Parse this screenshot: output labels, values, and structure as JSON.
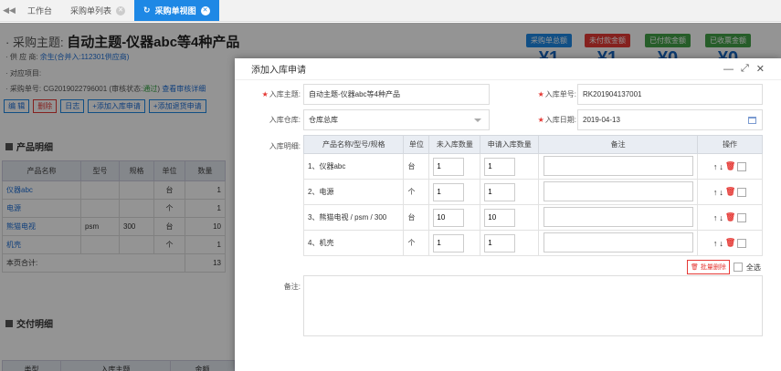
{
  "tabs": [
    {
      "label": "工作台",
      "active": false,
      "closable": false
    },
    {
      "label": "采购单列表",
      "active": false,
      "closable": true
    },
    {
      "label": "采购单视图",
      "active": true,
      "closable": true
    }
  ],
  "background": {
    "subject_label": "· 采购主题:",
    "subject_value": "自动主题-仪器abc等4种产品",
    "supplier_label": "· 供 应 商:",
    "supplier_value": "余生(合并入:112301供应商)",
    "project_label": "· 对应项目:",
    "order_no_label": "· 采购单号:",
    "order_no_value": "CG2019022796001",
    "audit_prefix": "(审核状态:",
    "audit_value": "通过",
    "audit_suffix": ")",
    "audit_link": "查看审核详细",
    "buttons": [
      "编 辑",
      "删除",
      "日志",
      "+添加入库申请",
      "+添加退货申请"
    ],
    "stats": [
      {
        "label": "采购单总额",
        "value": "¥1",
        "color": "#1e88e5"
      },
      {
        "label": "未付款金额",
        "value": "¥1",
        "color": "#e53935"
      },
      {
        "label": "已付款金额",
        "value": "¥0",
        "color": "#43a047"
      },
      {
        "label": "已收票金额",
        "value": "¥0",
        "color": "#43a047"
      }
    ],
    "product_section": "产品明细",
    "product_headers": [
      "产品名称",
      "型号",
      "规格",
      "单位",
      "数量"
    ],
    "product_rows": [
      [
        "仪器abc",
        "",
        "",
        "台",
        "1"
      ],
      [
        "电源",
        "",
        "",
        "个",
        "1"
      ],
      [
        "熊猫电视",
        "psm",
        "300",
        "台",
        "10"
      ],
      [
        "机壳",
        "",
        "",
        "个",
        "1"
      ]
    ],
    "page_total_label": "本页合计:",
    "page_total_value": "13",
    "delivery_section": "交付明细",
    "delivery_headers": [
      "类型",
      "入库主题",
      "金额"
    ]
  },
  "modal": {
    "title": "添加入库申请",
    "subject_label": "入库主题:",
    "subject_value": "自动主题-仪器abc等4种产品",
    "order_no_label": "入库单号:",
    "order_no_value": "RK201904137001",
    "warehouse_label": "入库仓库:",
    "warehouse_value": "仓库总库",
    "date_label": "入库日期:",
    "date_value": "2019-04-13",
    "detail_label": "入库明细:",
    "detail_headers": [
      "产品名称/型号/规格",
      "单位",
      "未入库数量",
      "申请入库数量",
      "备注",
      "操作"
    ],
    "detail_rows": [
      {
        "name": "1、仪器abc",
        "unit": "台",
        "pending": "1",
        "apply": "1"
      },
      {
        "name": "2、电源",
        "unit": "个",
        "pending": "1",
        "apply": "1"
      },
      {
        "name": "3、熊猫电视 / psm / 300",
        "unit": "台",
        "pending": "10",
        "apply": "10"
      },
      {
        "name": "4、机壳",
        "unit": "个",
        "pending": "1",
        "apply": "1"
      }
    ],
    "batch_delete": "批量删除",
    "select_all": "全选",
    "remark_label": "备注:"
  }
}
